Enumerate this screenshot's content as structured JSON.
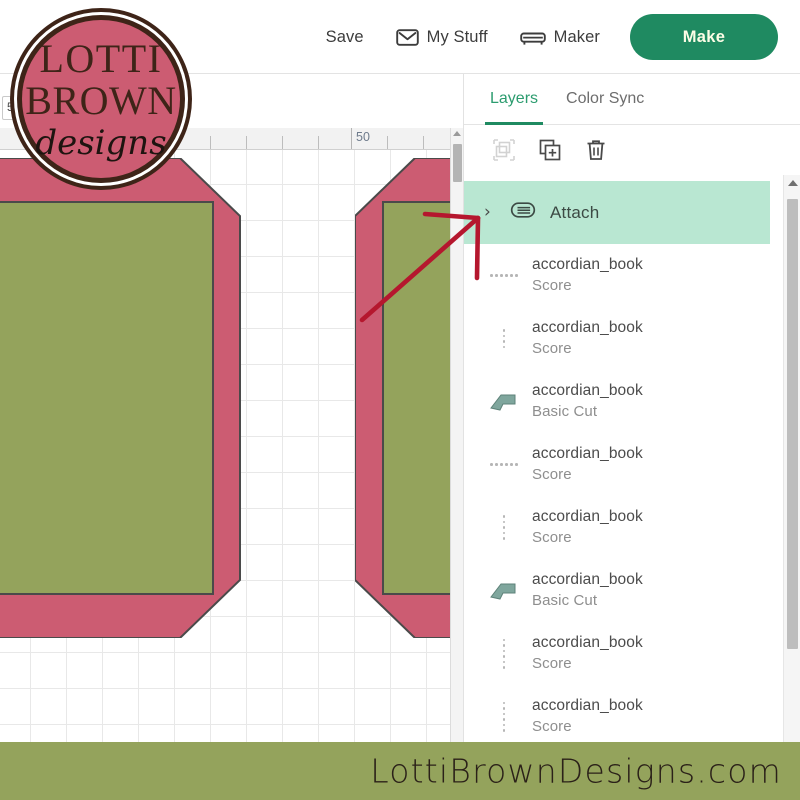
{
  "header": {
    "save_label": "Save",
    "my_stuff_label": "My Stuff",
    "my_stuff_icon": "envelope-icon",
    "machine_label": "Maker",
    "machine_icon": "cutting-machine-icon",
    "make_label": "Make",
    "make_color": "#1f8a61"
  },
  "canvas": {
    "size_value": "5.5",
    "ruler_label": "50",
    "shape_fill_outer": "#cc5c72",
    "shape_fill_inner": "#94a35c",
    "shape_stroke": "#4a4a4a",
    "grid_color": "#e8e8e8"
  },
  "panel": {
    "tabs": [
      {
        "label": "Layers",
        "active": true
      },
      {
        "label": "Color Sync",
        "active": false
      }
    ],
    "tools": [
      {
        "name": "group-icon",
        "disabled": true
      },
      {
        "name": "duplicate-icon",
        "disabled": false
      },
      {
        "name": "delete-icon",
        "disabled": false
      }
    ],
    "attach_row": {
      "label": "Attach",
      "icon": "paperclip-icon",
      "chevron": "›",
      "highlight_color": "#b9e7d2"
    },
    "layers": [
      {
        "title": "accordian_book",
        "type": "Score",
        "thumb": "score-horizontal-dots"
      },
      {
        "title": "accordian_book",
        "type": "Score",
        "thumb": "score-vertical-dots"
      },
      {
        "title": "accordian_book",
        "type": "Basic Cut",
        "thumb": "cut-shape"
      },
      {
        "title": "accordian_book",
        "type": "Score",
        "thumb": "score-horizontal-dots"
      },
      {
        "title": "accordian_book",
        "type": "Score",
        "thumb": "score-vertical-dots"
      },
      {
        "title": "accordian_book",
        "type": "Basic Cut",
        "thumb": "cut-shape"
      },
      {
        "title": "accordian_book",
        "type": "Score",
        "thumb": "score-vertical-dots"
      },
      {
        "title": "accordian_book",
        "type": "Score",
        "thumb": "score-vertical-dots"
      }
    ]
  },
  "annotation": {
    "arrow_color": "#b5172e",
    "name": "red-arrow-pointing-to-attach-layer"
  },
  "logo": {
    "line1": "LOTTI",
    "line2": "BROWN",
    "line3": "designs",
    "circle_fill": "#cc5c72",
    "ring_color": "#3e2418"
  },
  "footer": {
    "url": "LottiBrownDesigns.com",
    "background": "#94a35c"
  }
}
